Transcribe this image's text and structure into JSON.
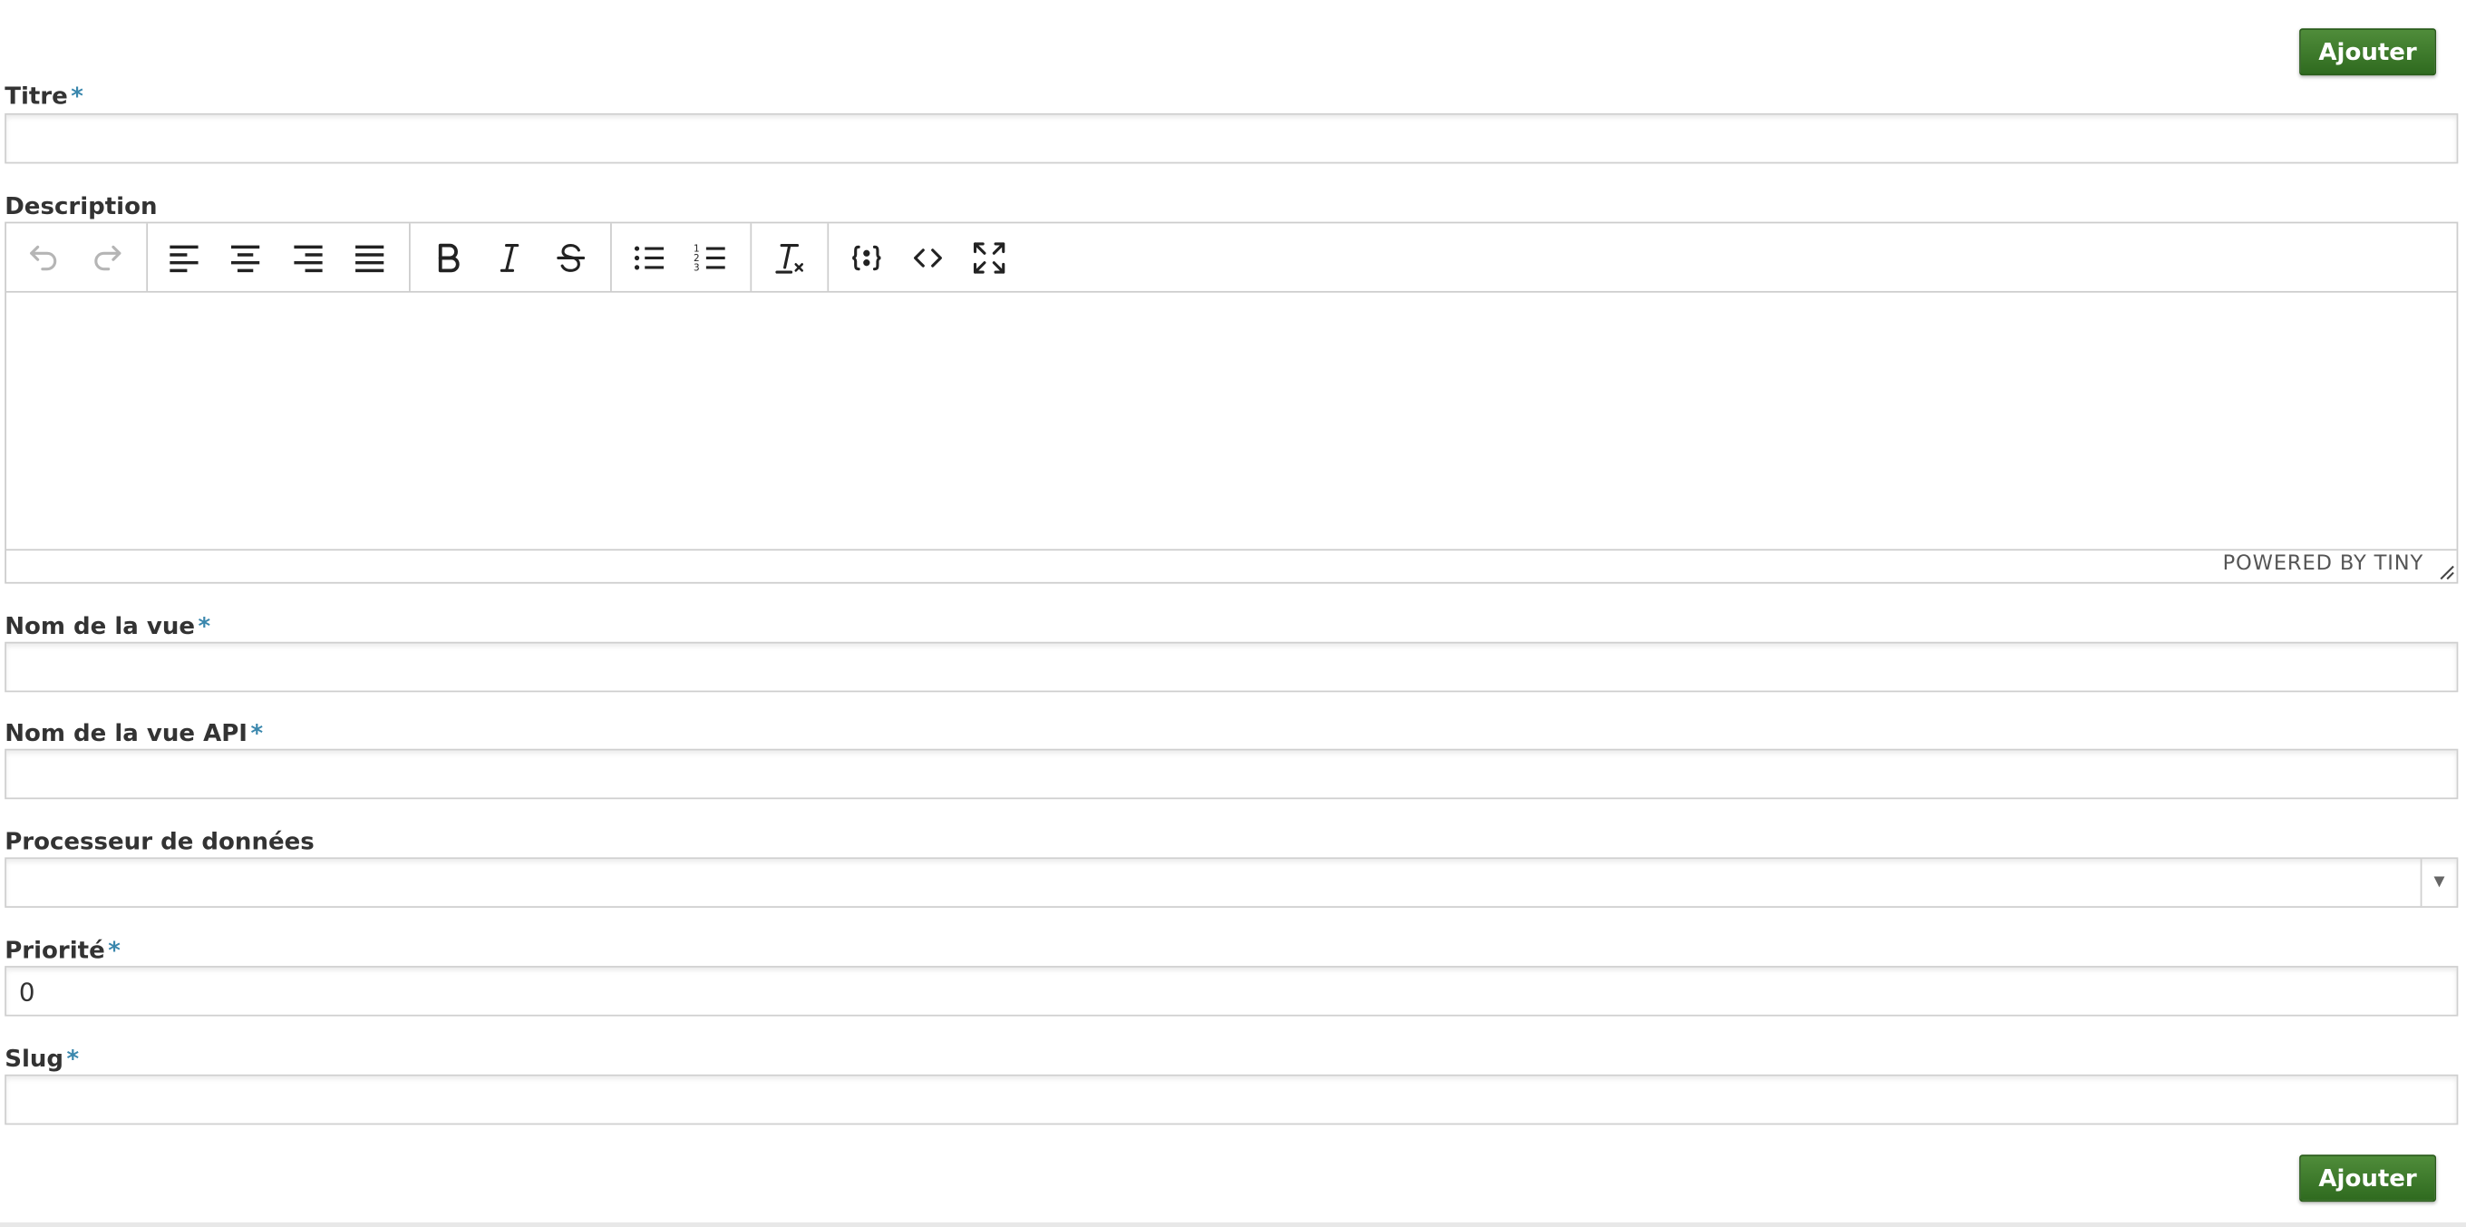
{
  "actions": {
    "add_label": "Ajouter"
  },
  "fields": {
    "title": {
      "label": "Titre",
      "required": "*",
      "value": ""
    },
    "description": {
      "label": "Description",
      "value": ""
    },
    "view_name": {
      "label": "Nom de la vue",
      "required": "*",
      "value": ""
    },
    "api_view_name": {
      "label": "Nom de la vue API",
      "required": "*",
      "value": ""
    },
    "data_processor": {
      "label": "Processeur de données",
      "selected": ""
    },
    "priority": {
      "label": "Priorité",
      "required": "*",
      "value": "0"
    },
    "slug": {
      "label": "Slug",
      "required": "*",
      "value": ""
    }
  },
  "editor": {
    "branding": "POWERED BY TINY",
    "toolbar_icons": [
      "undo-icon",
      "redo-icon",
      "align-left-icon",
      "align-center-icon",
      "align-right-icon",
      "align-justify-icon",
      "bold-icon",
      "italic-icon",
      "strikethrough-icon",
      "bullet-list-icon",
      "numbered-list-icon",
      "remove-format-icon",
      "template-icon",
      "source-code-icon",
      "fullscreen-icon"
    ]
  },
  "colors": {
    "button": "#3f7d2d",
    "required_marker": "#3a87ad"
  }
}
